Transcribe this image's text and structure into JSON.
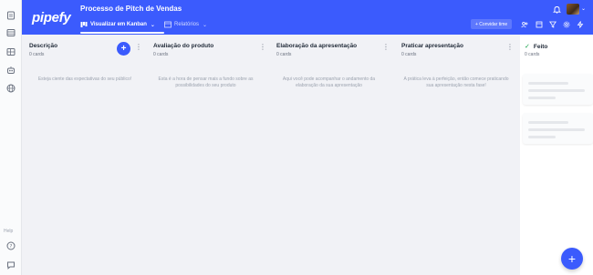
{
  "app": {
    "logo": "pipefy"
  },
  "header": {
    "process_title": "Processo de Pitch de Vendas",
    "tabs": [
      {
        "label": "Visualizar em Kanban",
        "icon": "kanban-icon",
        "active": true
      },
      {
        "label": "Relatórios",
        "icon": "reports-icon",
        "active": false
      }
    ],
    "invite_label": "+ Convidar time",
    "right_icons": [
      "members-icon",
      "import-icon",
      "filter-icon",
      "settings-icon",
      "automation-icon"
    ],
    "accent": "#3b5bfd"
  },
  "rail": {
    "icons": [
      "document-icon",
      "database-icon",
      "layout-icon",
      "robot-icon",
      "globe-icon"
    ],
    "help_label": "Help",
    "bottom_icons": [
      "help-circle-icon",
      "chat-icon"
    ]
  },
  "columns": [
    {
      "title": "Descrição",
      "count": "0 cards",
      "empty_text": "Esteja ciente das expectativas do seu público!"
    },
    {
      "title": "Avaliação do produto",
      "count": "0 cards",
      "empty_text": "Esta é a hora de pensar mais a fundo sobre as possibilidades do seu produto"
    },
    {
      "title": "Elaboração da apresentação",
      "count": "0 cards",
      "empty_text": "Aqui você pode acompanhar o andamento da elaboração da sua apresentação"
    },
    {
      "title": "Praticar apresentação",
      "count": "0 cards",
      "empty_text": "A prática leva à perfeição, então comece praticando sua apresentação nesta fase!"
    }
  ],
  "done_column": {
    "title": "Feito",
    "count": "0 cards"
  },
  "fab_label": "+",
  "add_label": "+"
}
